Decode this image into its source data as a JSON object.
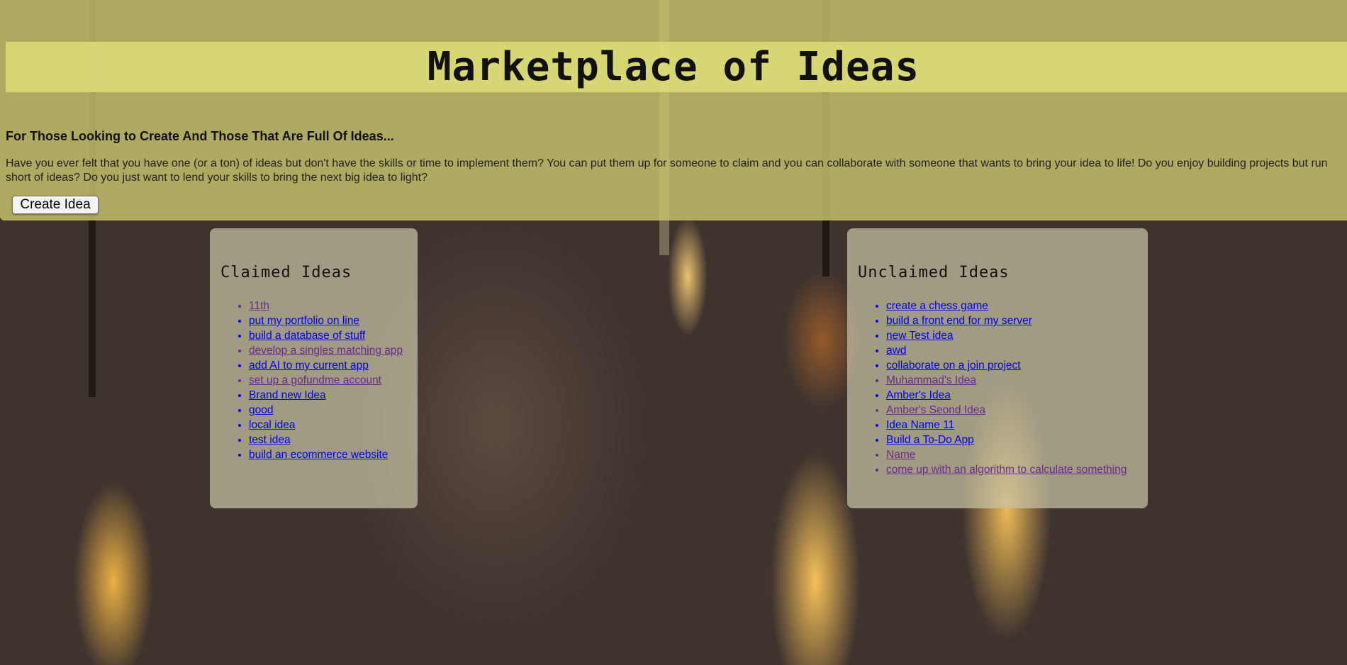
{
  "header": {
    "title": "Marketplace of Ideas",
    "subtitle": "For Those Looking to Create And Those That Are Full Of Ideas...",
    "description": "Have you ever felt that you have one (or a ton) of ideas but don't have the skills or time to implement them? You can put them up for someone to claim and you can collaborate with someone that wants to bring your idea to life! Do you enjoy building projects but run short of ideas? Do you just want to lend your skills to bring the next big idea to light?",
    "create_button": "Create Idea"
  },
  "claimed": {
    "heading": "Claimed Ideas",
    "items": [
      {
        "label": "11th",
        "visited": true
      },
      {
        "label": "put my portfolio on line",
        "visited": false
      },
      {
        "label": "build a database of stuff",
        "visited": false
      },
      {
        "label": "develop a singles matching app",
        "visited": true
      },
      {
        "label": "add AI to my current app",
        "visited": false
      },
      {
        "label": "set up a gofundme account",
        "visited": true
      },
      {
        "label": "Brand new Idea",
        "visited": false
      },
      {
        "label": "good",
        "visited": false
      },
      {
        "label": "local idea",
        "visited": false
      },
      {
        "label": "test idea",
        "visited": false
      },
      {
        "label": "build an ecommerce website",
        "visited": false
      }
    ]
  },
  "unclaimed": {
    "heading": "Unclaimed Ideas",
    "items": [
      {
        "label": "create a chess game",
        "visited": false
      },
      {
        "label": "build a front end for my server",
        "visited": false
      },
      {
        "label": "new Test idea",
        "visited": false
      },
      {
        "label": "awd",
        "visited": false
      },
      {
        "label": "collaborate on a join project",
        "visited": false
      },
      {
        "label": "Muhammad's Idea",
        "visited": true
      },
      {
        "label": "Amber's Idea",
        "visited": false
      },
      {
        "label": "Amber's Seond Idea",
        "visited": true
      },
      {
        "label": "Idea Name 11",
        "visited": false
      },
      {
        "label": "Build a To-Do App",
        "visited": false
      },
      {
        "label": "Name",
        "visited": true
      },
      {
        "label": "come up with an algorithm to calculate something",
        "visited": true
      }
    ]
  },
  "colors": {
    "link": "#0000ee",
    "visited": "#6a2a8a",
    "hero": "#c8c46e"
  }
}
